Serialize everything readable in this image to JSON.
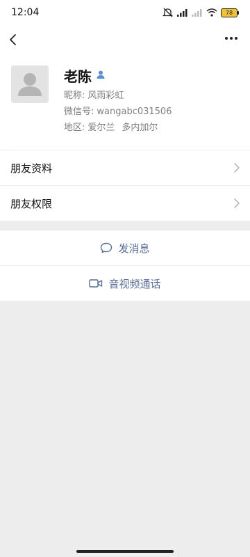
{
  "status_bar": {
    "time": "12:04",
    "battery": "78",
    "icons": [
      "mute-icon",
      "signal-icon",
      "signal-icon",
      "wifi-icon",
      "battery-icon"
    ]
  },
  "nav": {
    "back_icon": "chevron-left-icon",
    "more_icon": "more-horizontal-icon"
  },
  "profile": {
    "name": "老陈",
    "nickname_label": "昵称:",
    "nickname": "风雨彩虹",
    "wechat_id_label": "微信号:",
    "wechat_id": "wangabc031506",
    "region_label": "地区:",
    "region_country": "爱尔兰",
    "region_city": "多内加尔"
  },
  "menu": {
    "items": [
      {
        "label": "朋友资料"
      },
      {
        "label": "朋友权限"
      }
    ]
  },
  "actions": {
    "message": "发消息",
    "call": "音视频通话",
    "accent": "#576b95"
  }
}
